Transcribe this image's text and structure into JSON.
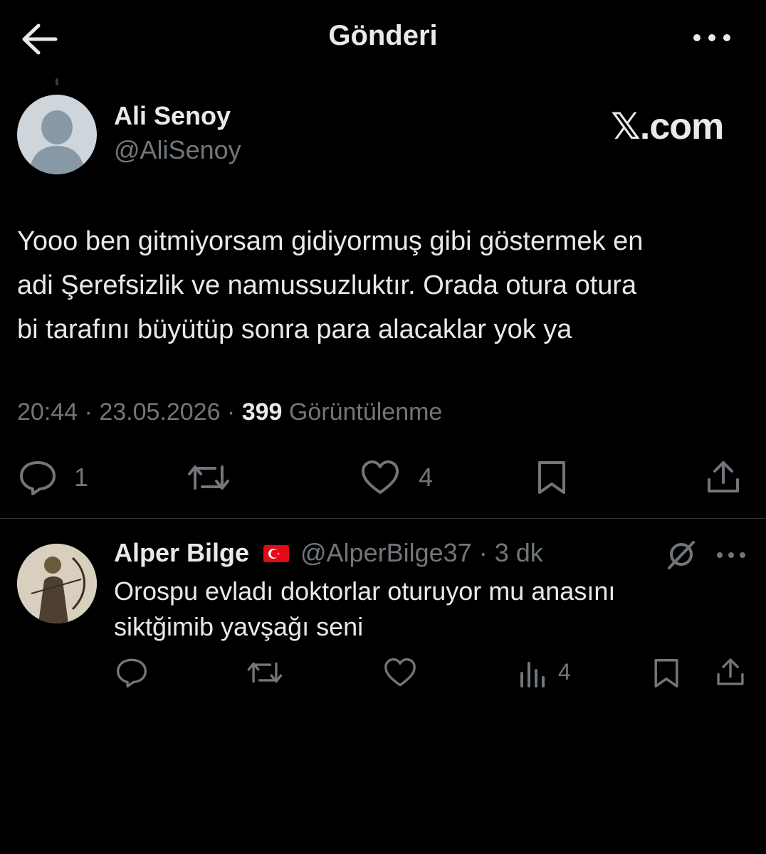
{
  "header": {
    "title": "Gönderi",
    "back_icon": "arrow-left-icon",
    "more_icon": "more-horizontal-icon"
  },
  "tweet": {
    "author_name": "Ali Senoy",
    "author_handle": "@AliSenoy",
    "watermark": "𝕏.com",
    "text": "Yooo ben gitmiyorsam gidiyormuş gibi göstermek en\nadi Şerefsizlik ve namussuzluktır. Orada otura otura\nbi tarafını büyütüp sonra para alacaklar yok ya",
    "time": "20:44",
    "date": "23.05.2026",
    "views": "399",
    "views_label": "Görüntülenme",
    "reply_count": "1",
    "like_count": "4",
    "icons": [
      "reply-icon",
      "retweet-icon",
      "like-icon",
      "bookmark-icon",
      "share-icon"
    ]
  },
  "reply": {
    "author_name": "Alper Bilge",
    "author_handle": "@AlperBilge37",
    "time_ago": "3 dk",
    "text": "Orospu evladı doktorlar oturuyor mu anasını\nsiktğimib yavşağı seni",
    "views_count": "4",
    "icons": [
      "grok-icon",
      "more-horizontal-icon",
      "reply-icon",
      "retweet-icon",
      "like-icon",
      "views-icon",
      "bookmark-icon",
      "share-icon"
    ]
  },
  "colors": {
    "background": "#000000",
    "text": "#e7e9ea",
    "muted": "#71767b",
    "divider": "#2f3336"
  }
}
